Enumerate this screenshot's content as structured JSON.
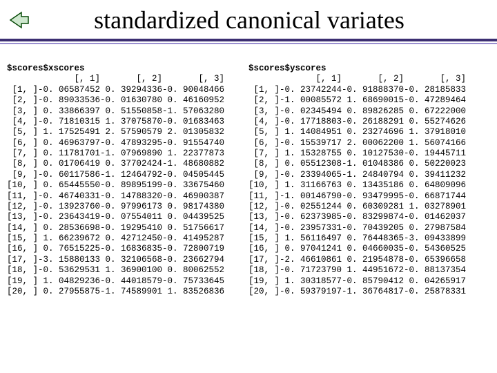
{
  "title": "standardized canonical variates",
  "blocks": [
    {
      "title": "$scores$xscores",
      "col_headers": [
        "[, 1]",
        "[, 2]",
        "[, 3]"
      ],
      "row_labels": [
        "[1, ]",
        "[2, ]",
        "[3, ]",
        "[4, ]",
        "[5, ]",
        "[6, ]",
        "[7, ]",
        "[8, ]",
        "[9, ]",
        "[10, ]",
        "[11, ]",
        "[12, ]",
        "[13, ]",
        "[14, ]",
        "[15, ]",
        "[16, ]",
        "[17, ]",
        "[18, ]",
        "[19, ]",
        "[20, ]"
      ],
      "values": [
        [
          "-0. 06587452",
          " 0. 39294336",
          "-0. 90048466"
        ],
        [
          "-0. 89033536",
          "-0. 01630780",
          " 0. 46160952"
        ],
        [
          " 0. 33866397",
          " 0. 51550858",
          "-1. 57063280"
        ],
        [
          "-0. 71810315",
          " 1. 37075870",
          "-0. 01683463"
        ],
        [
          " 1. 17525491",
          " 2. 57590579",
          " 2. 01305832"
        ],
        [
          " 0. 46963797",
          "-0. 47893295",
          "-0. 91554740"
        ],
        [
          " 0. 11781701",
          "-1. 07969890",
          " 1. 22377873"
        ],
        [
          " 0. 01706419",
          " 0. 37702424",
          "-1. 48680882"
        ],
        [
          "-0. 60117586",
          "-1. 12464792",
          "-0. 04505445"
        ],
        [
          " 0. 65445550",
          "-0. 89895199",
          "-0. 33675460"
        ],
        [
          "-0. 46740331",
          "-0. 14788320",
          "-0. 46900387"
        ],
        [
          "-0. 13923760",
          "-0. 97996173",
          " 0. 98174380"
        ],
        [
          "-0. 23643419",
          "-0. 07554011",
          " 0. 04439525"
        ],
        [
          " 0. 28536698",
          "-0. 19295410",
          " 0. 51756617"
        ],
        [
          " 1. 66239672",
          " 0. 42712450",
          "-0. 41495287"
        ],
        [
          " 0. 76515225",
          "-0. 16836835",
          "-0. 72800719"
        ],
        [
          "-3. 15880133",
          " 0. 32106568",
          "-0. 23662794"
        ],
        [
          "-0. 53629531",
          " 1. 36900100",
          " 0. 80062552"
        ],
        [
          " 1. 04829236",
          "-0. 44018579",
          "-0. 75733645"
        ],
        [
          " 0. 27955875",
          "-1. 74589901",
          " 1. 83526836"
        ]
      ]
    },
    {
      "title": "$scores$yscores",
      "col_headers": [
        "[, 1]",
        "[, 2]",
        "[, 3]"
      ],
      "row_labels": [
        "[1, ]",
        "[2, ]",
        "[3, ]",
        "[4, ]",
        "[5, ]",
        "[6, ]",
        "[7, ]",
        "[8, ]",
        "[9, ]",
        "[10, ]",
        "[11, ]",
        "[12, ]",
        "[13, ]",
        "[14, ]",
        "[15, ]",
        "[16, ]",
        "[17, ]",
        "[18, ]",
        "[19, ]",
        "[20, ]"
      ],
      "values": [
        [
          "-0. 23742244",
          "-0. 91888370",
          "-0. 28185833"
        ],
        [
          "-1. 00085572",
          " 1. 68690015",
          "-0. 47289464"
        ],
        [
          "-0. 02345494",
          " 0. 89826285",
          " 0. 67222000"
        ],
        [
          "-0. 17718803",
          "-0. 26188291",
          " 0. 55274626"
        ],
        [
          " 1. 14084951",
          " 0. 23274696",
          " 1. 37918010"
        ],
        [
          "-0. 15539717",
          " 2. 00062200",
          " 1. 56074166"
        ],
        [
          " 1. 15328755",
          " 0. 10127530",
          "-0. 19445711"
        ],
        [
          " 0. 05512308",
          "-1. 01048386",
          " 0. 50220023"
        ],
        [
          "-0. 23394065",
          "-1. 24840794",
          " 0. 39411232"
        ],
        [
          " 1. 31166763",
          " 0. 13435186",
          " 0. 64809096"
        ],
        [
          "-1. 00146790",
          "-0. 93479995",
          "-0. 66871744"
        ],
        [
          "-0. 02551244",
          " 0. 60309281",
          " 1. 03278901"
        ],
        [
          "-0. 62373985",
          "-0. 83299874",
          "-0. 01462037"
        ],
        [
          "-0. 23957331",
          "-0. 70439205",
          " 0. 27987584"
        ],
        [
          " 1. 56116497",
          " 0. 76448365",
          "-3. 09433899"
        ],
        [
          " 0. 97041241",
          " 0. 04660035",
          "-0. 54360525"
        ],
        [
          "-2. 46610861",
          " 0. 21954878",
          "-0. 65396658"
        ],
        [
          "-0. 71723790",
          " 1. 44951672",
          "-0. 88137354"
        ],
        [
          " 1. 30318577",
          "-0. 85790412",
          " 0. 04265917"
        ],
        [
          "-0. 59379197",
          "-1. 36764817",
          "-0. 25878331"
        ]
      ]
    }
  ]
}
